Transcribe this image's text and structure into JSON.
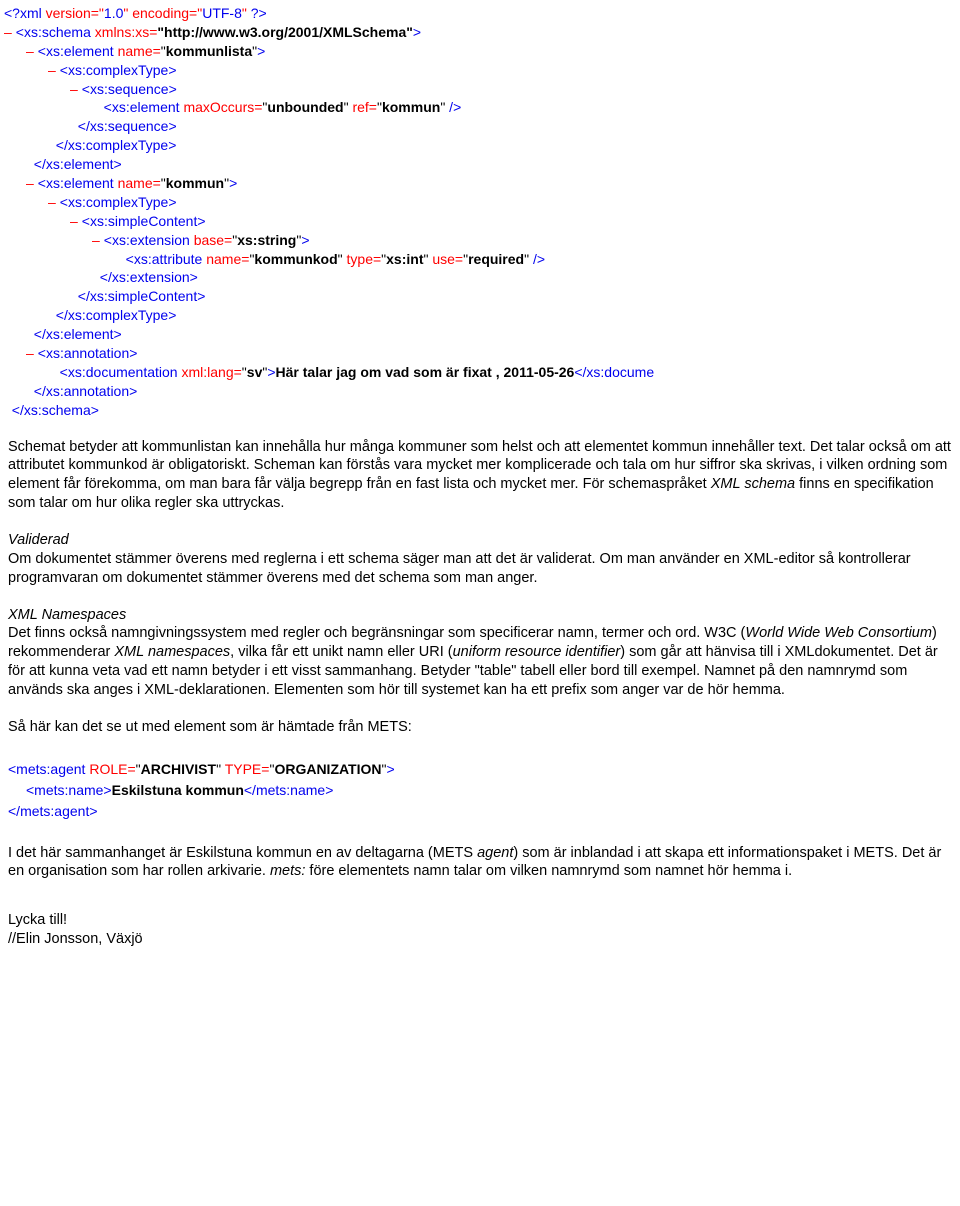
{
  "xml": {
    "l0": "<?xml version=\"1.0\" encoding=\"UTF-8\" ?>",
    "schema_open": {
      "tag": "xs:schema",
      "attr": "xmlns:xs=",
      "val": "\"http://www.w3.org/2001/XMLSchema\""
    },
    "el_kommunlista": {
      "tag": "xs:element",
      "attr": "name=",
      "bold": "kommunlista"
    },
    "complexType_open": "<xs:complexType>",
    "sequence_open": "<xs:sequence>",
    "el_ref_kommun": {
      "tag": "xs:element",
      "a1": "maxOccurs=",
      "b1": "unbounded",
      "a2": "ref=",
      "b2": "kommun"
    },
    "sequence_close": "</xs:sequence>",
    "complexType_close": "</xs:complexType>",
    "element_close": "</xs:element>",
    "el_kommun": {
      "tag": "xs:element",
      "attr": "name=",
      "bold": "kommun"
    },
    "simpleContent_open": "<xs:simpleContent>",
    "extension": {
      "tag": "xs:extension",
      "attr": "base=",
      "bold": "xs:string"
    },
    "attribute": {
      "tag": "xs:attribute",
      "a1": "name=",
      "b1": "kommunkod",
      "a2": "type=",
      "b2": "xs:int",
      "a3": "use=",
      "b3": "required"
    },
    "extension_close": "</xs:extension>",
    "simpleContent_close": "</xs:simpleContent>",
    "annotation_open": "<xs:annotation>",
    "documentation": {
      "tag": "xs:documentation",
      "attr": "xml:lang=",
      "bold": "sv",
      "text": "Här talar jag om vad som är fixat , 2011-05-26",
      "closetag": "</xs:docume"
    },
    "annotation_close": "</xs:annotation>",
    "schema_close": "</xs:schema>"
  },
  "prose": {
    "p1": "Schemat betyder att kommunlistan kan innehålla hur många kommuner som helst och att elementet kommun innehåller text. Det talar också om att attributet kommunkod är obligatoriskt. Scheman kan förstås vara mycket mer komplicerade och tala om hur siffror ska skrivas, i vilken ordning som element får förekomma, om man bara får välja begrepp från en fast lista och mycket mer. För schemaspråket ",
    "p1_i": "XML schema",
    "p1_b": " finns en specifikation som talar om hur olika regler ska uttryckas.",
    "h2": "Validerad",
    "p2": "Om dokumentet stämmer överens med reglerna i ett schema säger man att det är validerat. Om man använder en XML-editor så kontrollerar programvaran om dokumentet stämmer överens med det schema som man anger.",
    "h3": "XML Namespaces",
    "p3a": "Det finns också namngivningssystem med regler och begränsningar som specificerar namn, termer och ord. W3C (",
    "p3i1": "World Wide Web Consortium",
    "p3b": ") rekommenderar ",
    "p3i2": "XML namespaces",
    "p3c": ", vilka får ett unikt namn eller URI (",
    "p3i3": "uniform resource identifier",
    "p3d": ") som går att hänvisa till i XMLdokumentet. Det är för att kunna veta vad ett namn betyder i ett visst sammanhang. Betyder \"table\" tabell eller bord till exempel. Namnet på den namnrymd som används ska anges i XML-deklarationen. Elementen som hör till systemet kan ha ett prefix som anger var de hör hemma.",
    "p4": "Så här kan det se ut med element som är hämtade från METS:",
    "snippet": {
      "l1": {
        "open": "<mets:agent ",
        "a1": "ROLE=",
        "b1": "ARCHIVIST",
        "a2": " TYPE=",
        "b2": "ORGANIZATION",
        "close": ">"
      },
      "l2": {
        "open": "<mets:name>",
        "text": "Eskilstuna kommun",
        "close": "</mets:name>"
      },
      "l3": "</mets:agent>"
    },
    "p5a": "I det här sammanhanget är Eskilstuna kommun en av deltagarna (METS ",
    "p5i": "agent",
    "p5b": ") som är inblandad i att skapa ett informationspaket i METS. Det är en organisation som har rollen arkivarie. ",
    "p5i2": "mets:",
    "p5c": " före elementets namn talar om vilken namnrymd som namnet hör hemma i.",
    "sig1": "Lycka till!",
    "sig2": "//Elin Jonsson, Växjö"
  }
}
